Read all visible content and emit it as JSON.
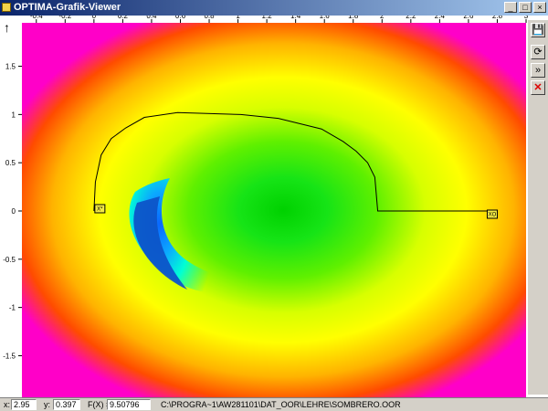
{
  "window": {
    "title": "OPTIMA-Grafik-Viewer",
    "buttons": [
      "_",
      "□",
      "×"
    ]
  },
  "toolbar": {
    "items": [
      {
        "icon": "save-icon"
      },
      {
        "icon": "refresh-icon"
      },
      {
        "icon": "double-arrow-icon"
      },
      {
        "icon": "close-icon"
      }
    ]
  },
  "plot": {
    "x_ticks": [
      "-0.4",
      "-0.2",
      "0",
      "0.2",
      "0.4",
      "0.6",
      "0.8",
      "1",
      "1.2",
      "1.4",
      "1.6",
      "1.8",
      "2",
      "2.2",
      "2.4",
      "2.6",
      "2.8",
      "3"
    ],
    "y_ticks": [
      "1.5",
      "1",
      "0.5",
      "0",
      "-0.5",
      "-1",
      "-1.5"
    ],
    "y_axis_arrow": "↑",
    "start_label": "XO",
    "end_label": "X*",
    "colors": {
      "frame_bg": "#ffffff",
      "path": "#000000",
      "marker_fill": "#f3ea45",
      "axis_text": "#000000"
    }
  },
  "chart_data": {
    "type": "heatmap",
    "title": "",
    "xlabel": "",
    "ylabel": "",
    "xlim": [
      -0.5,
      3.0
    ],
    "ylim": [
      -1.95,
      1.95
    ],
    "grid": false,
    "legend": "none",
    "path_points": [
      [
        2.8,
        0.0
      ],
      [
        1.97,
        0.0
      ],
      [
        1.95,
        0.35
      ],
      [
        1.9,
        0.5
      ],
      [
        1.82,
        0.62
      ],
      [
        1.73,
        0.72
      ],
      [
        1.58,
        0.85
      ],
      [
        1.28,
        0.96
      ],
      [
        1.02,
        1.0
      ],
      [
        0.58,
        1.02
      ],
      [
        0.35,
        0.97
      ],
      [
        0.22,
        0.86
      ],
      [
        0.12,
        0.75
      ],
      [
        0.05,
        0.58
      ],
      [
        0.01,
        0.3
      ],
      [
        0.0,
        0.0
      ]
    ],
    "start_point": [
      2.8,
      0.0
    ],
    "end_point": [
      0.0,
      0.0
    ]
  },
  "status": {
    "x_label": "x:",
    "x_value": "2.95",
    "y_label": "y:",
    "y_value": "0.397",
    "f_label": "F(X) =",
    "f_value": "9.50796",
    "path": "C:\\PROGRA~1\\AW281101\\DAT_OOR\\LEHRE\\SOMBRERO.OOR"
  }
}
